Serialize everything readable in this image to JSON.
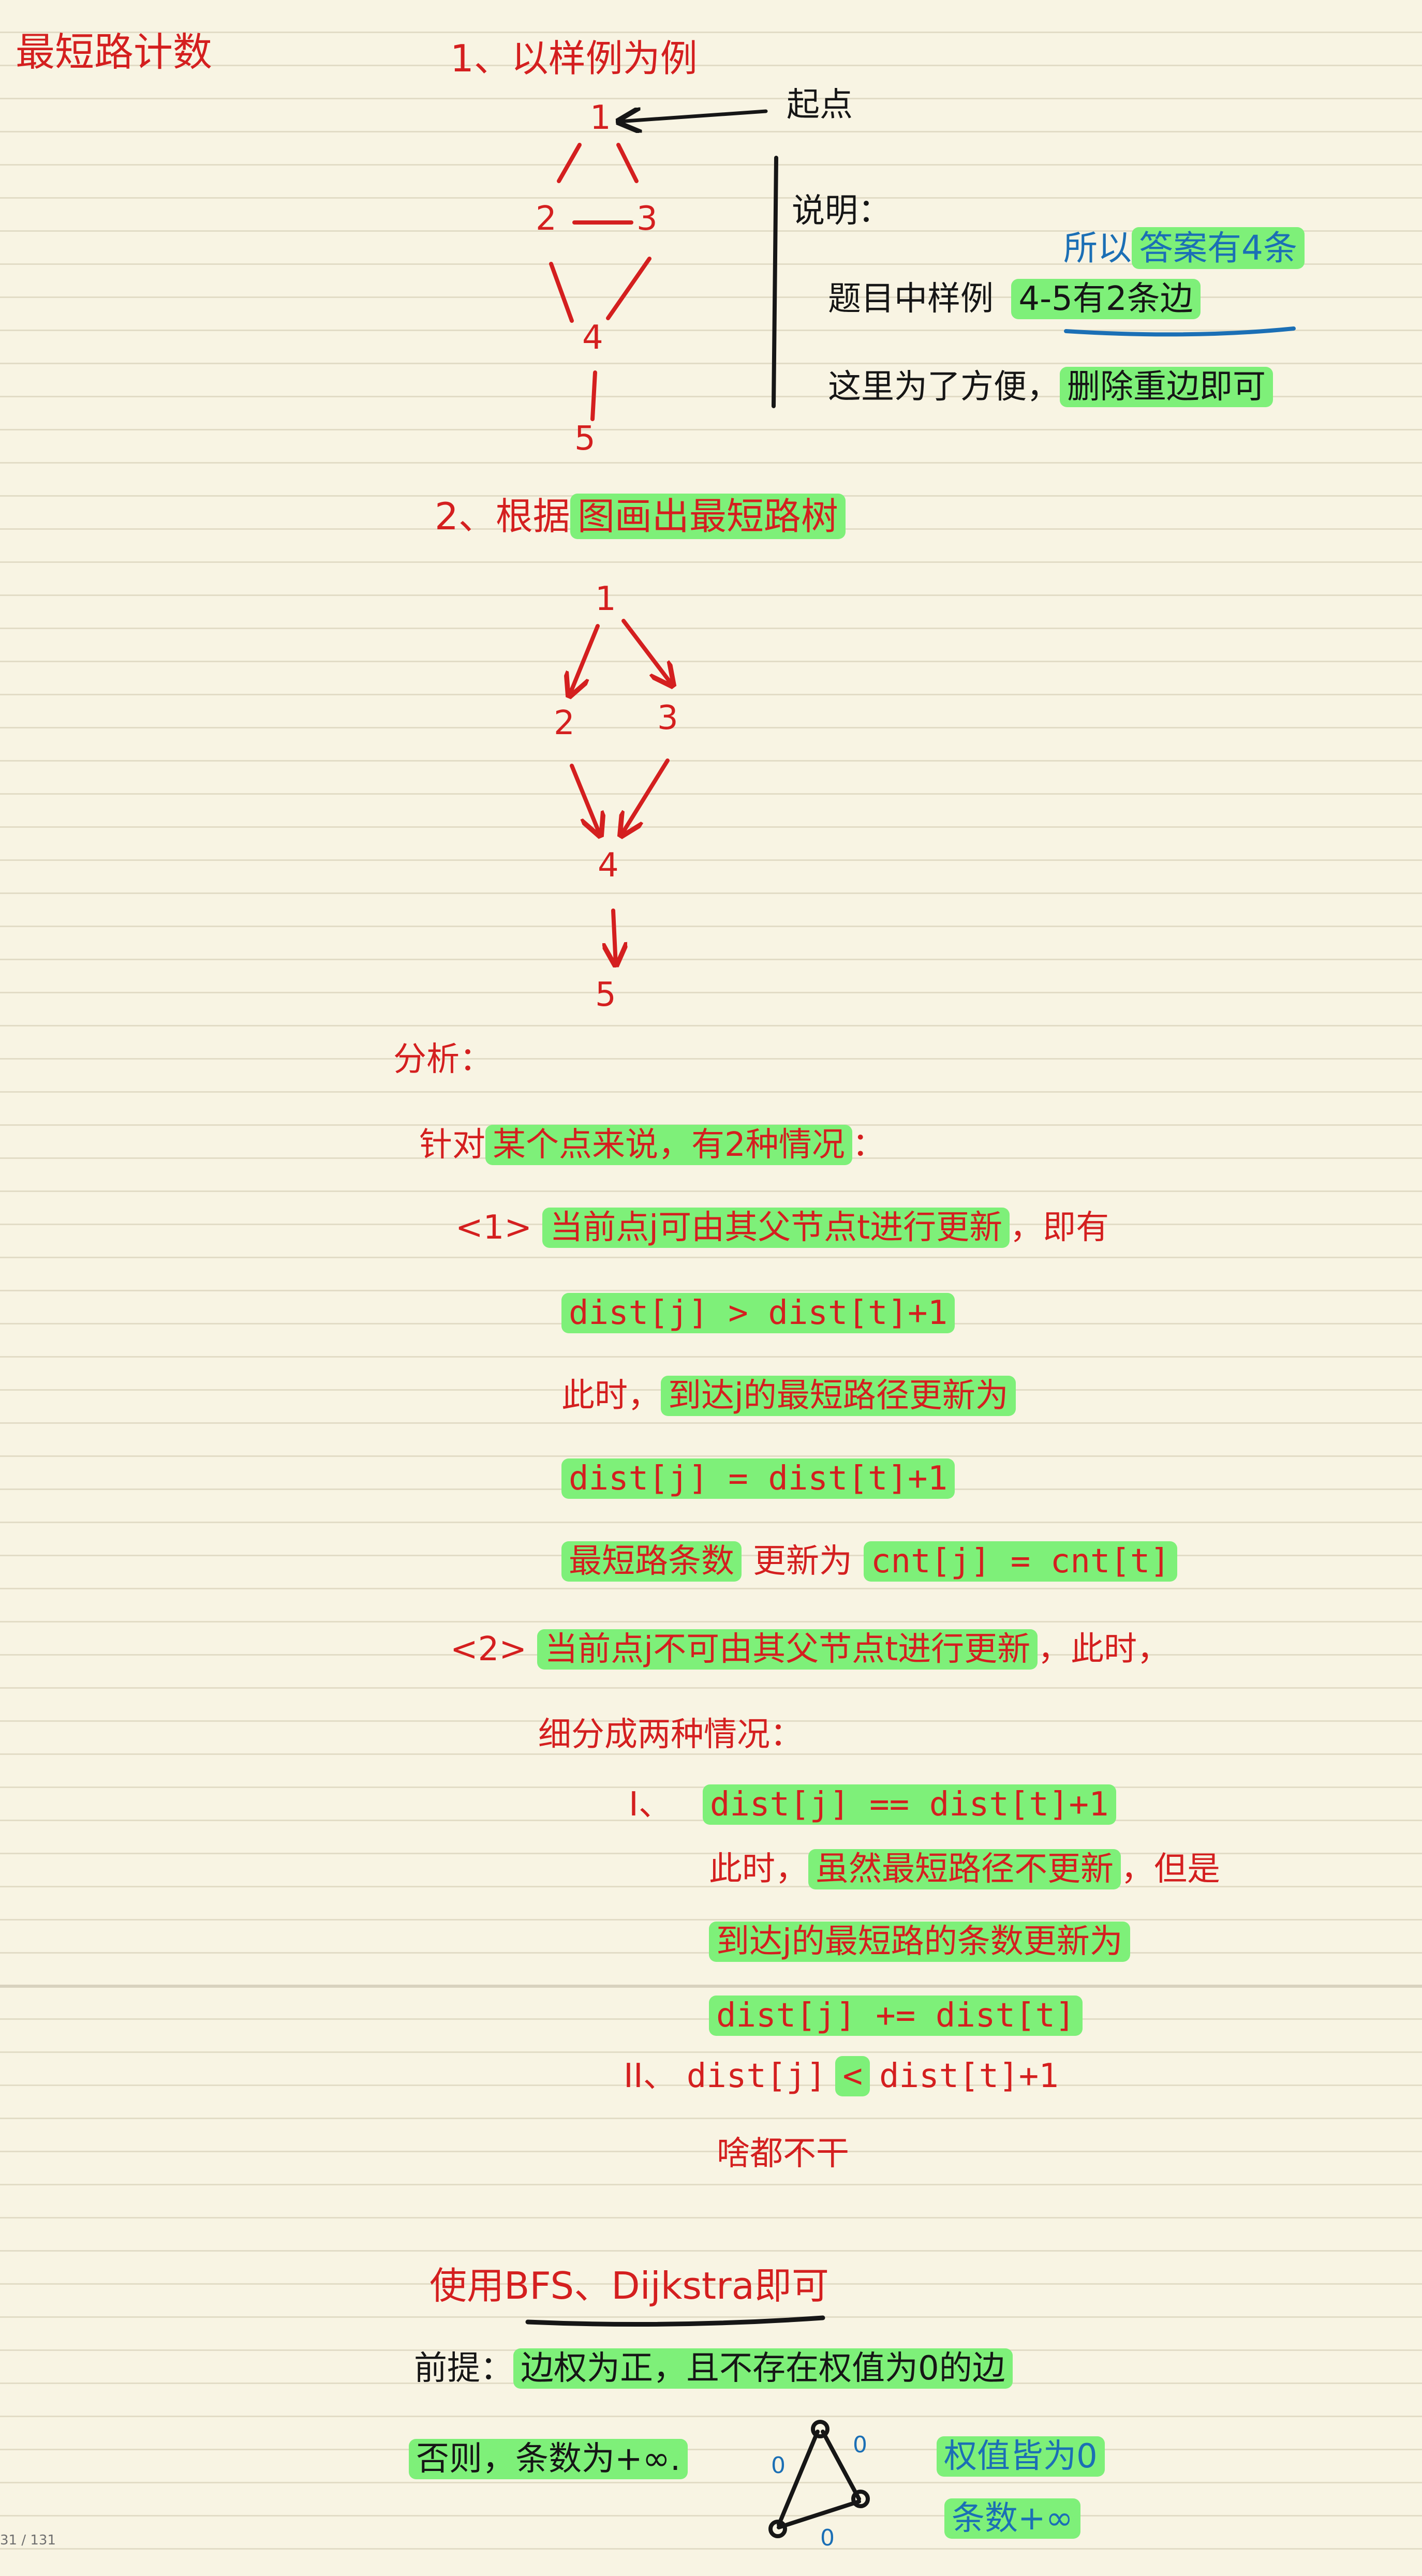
{
  "title": "最短路计数",
  "section1": {
    "heading": "1、以样例为例",
    "start_label": "起点",
    "note_title": "说明：",
    "note_line1": "题目中样例",
    "note_line1_hl": "4-5有2条边",
    "note_line2": "这里为了方便，",
    "note_line2_hl": "删除重边即可",
    "blue_note_prefix": "所以",
    "blue_note_hl": "答案有4条",
    "graph_nodes": [
      "1",
      "2",
      "3",
      "4",
      "5"
    ]
  },
  "section2": {
    "heading_prefix": "2、根据",
    "heading_hl": "图画出最短路树",
    "tree_nodes": [
      "1",
      "2",
      "3",
      "4",
      "5"
    ]
  },
  "analysis": {
    "label": "分析：",
    "intro_prefix": "针对",
    "intro_hl": "某个点来说，有2种情况",
    "intro_suffix": "：",
    "case1_marker": "<1>",
    "case1_hl": "当前点j可由其父节点t进行更新",
    "case1_suffix": "，即有",
    "case1_cond": "dist[j] > dist[t]+1",
    "case1_then_prefix": "此时，",
    "case1_then_hl": "到达j的最短路径更新为",
    "case1_assign": "dist[j] = dist[t]+1",
    "case1_cnt_hl": "最短路条数",
    "case1_cnt_mid": "更新为",
    "case1_cnt_assign": "cnt[j] = cnt[t]",
    "case2_marker": "<2>",
    "case2_hl": "当前点j不可由其父节点t进行更新",
    "case2_suffix": "，此时，",
    "case2_split": "细分成两种情况：",
    "sub1_marker": "I、",
    "sub1_cond": "dist[j] == dist[t]+1",
    "sub1_then_prefix": "此时，",
    "sub1_then_hl": "虽然最短路径不更新",
    "sub1_then_suffix": "，但是",
    "sub1_line2": "到达j的最短路的条数更新为",
    "sub1_assign": "dist[j] += dist[t]",
    "sub2_marker": "II、",
    "sub2_left": "dist[j]",
    "sub2_op": "<",
    "sub2_right": "dist[t]+1",
    "sub2_result": "啥都不干"
  },
  "conclusion": {
    "use_line": "使用BFS、Dijkstra即可",
    "premise_label": "前提：",
    "premise_hl": "边权为正，且不存在权值为0的边",
    "otherwise": "否则，条数为+∞.",
    "blue_note_line1": "权值皆为0",
    "blue_note_line2": "条数+∞",
    "small_graph_edge_labels": [
      "0",
      "0",
      "0"
    ]
  },
  "page_indicator": "31 / 131",
  "colors": {
    "red_ink": "#d41f1f",
    "black_ink": "#161616",
    "blue_ink": "#1b6fb5",
    "highlighter": "#7ef079",
    "paper": "#f8f4e3"
  }
}
